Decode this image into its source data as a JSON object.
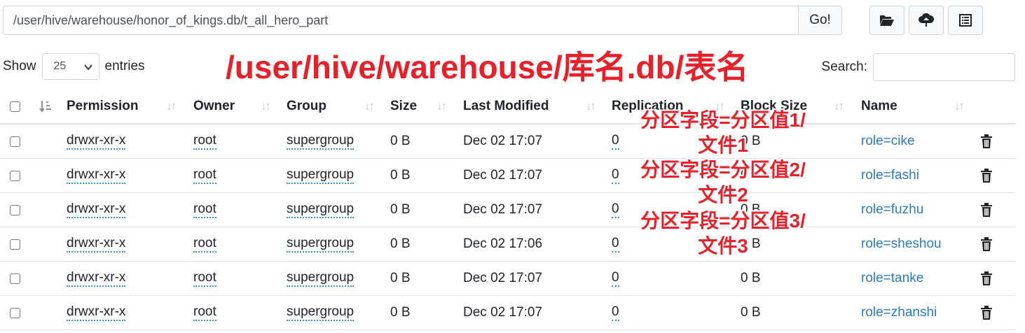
{
  "path_bar": {
    "value": "/user/hive/warehouse/honor_of_kings.db/t_all_hero_part",
    "go_label": "Go!"
  },
  "toolbar_icons": [
    "folder-open-icon",
    "cloud-upload-icon",
    "list-icon"
  ],
  "length": {
    "show_label": "Show",
    "selected": "25",
    "entries_label": "entries"
  },
  "search": {
    "label": "Search:",
    "value": ""
  },
  "annotation_title": "/user/hive/warehouse/库名.db/表名",
  "table": {
    "headers": {
      "permission": "Permission",
      "owner": "Owner",
      "group": "Group",
      "size": "Size",
      "last_modified": "Last Modified",
      "replication": "Replication",
      "block_size": "Block Size",
      "name": "Name"
    },
    "rows": [
      {
        "permission": "drwxr-xr-x",
        "owner": "root",
        "group": "supergroup",
        "size": "0 B",
        "last_modified": "Dec 02 17:07",
        "replication": "0",
        "block_size": "0 B",
        "name": "role=cike"
      },
      {
        "permission": "drwxr-xr-x",
        "owner": "root",
        "group": "supergroup",
        "size": "0 B",
        "last_modified": "Dec 02 17:07",
        "replication": "0",
        "block_size": "0 B",
        "name": "role=fashi"
      },
      {
        "permission": "drwxr-xr-x",
        "owner": "root",
        "group": "supergroup",
        "size": "0 B",
        "last_modified": "Dec 02 17:07",
        "replication": "0",
        "block_size": "0 B",
        "name": "role=fuzhu"
      },
      {
        "permission": "drwxr-xr-x",
        "owner": "root",
        "group": "supergroup",
        "size": "0 B",
        "last_modified": "Dec 02 17:06",
        "replication": "0",
        "block_size": "0 B",
        "name": "role=sheshou"
      },
      {
        "permission": "drwxr-xr-x",
        "owner": "root",
        "group": "supergroup",
        "size": "0 B",
        "last_modified": "Dec 02 17:07",
        "replication": "0",
        "block_size": "0 B",
        "name": "role=tanke"
      },
      {
        "permission": "drwxr-xr-x",
        "owner": "root",
        "group": "supergroup",
        "size": "0 B",
        "last_modified": "Dec 02 17:07",
        "replication": "0",
        "block_size": "0 B",
        "name": "role=zhanshi"
      }
    ]
  },
  "annotations": [
    {
      "line1": "分区字段=分区值1/",
      "line2": "文件1"
    },
    {
      "line1": "分区字段=分区值2/",
      "line2": "文件2"
    },
    {
      "line1": "分区字段=分区值3/",
      "line2": "文件3"
    }
  ],
  "colors": {
    "annotation": "#e8202a",
    "link": "#2a7bbf"
  }
}
